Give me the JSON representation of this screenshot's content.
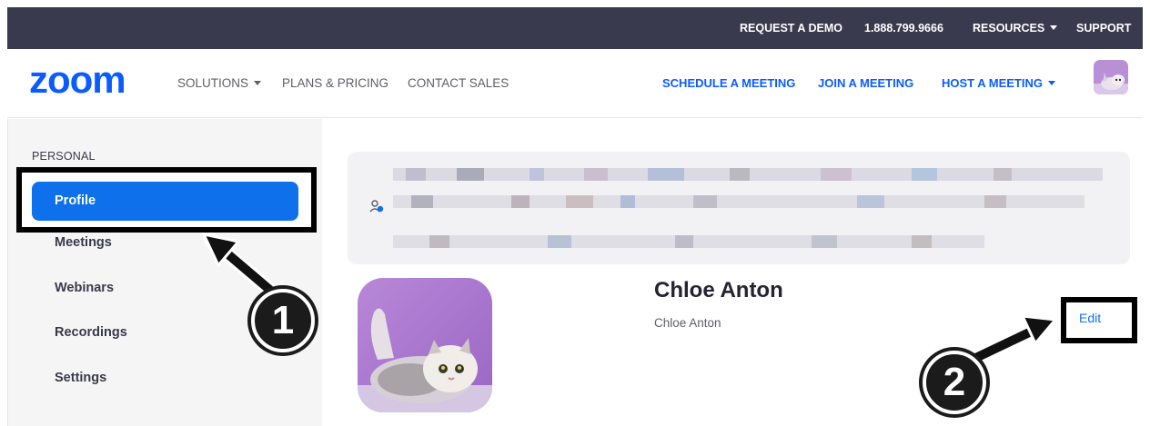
{
  "topbar": {
    "request_demo": "REQUEST A DEMO",
    "phone": "1.888.799.9666",
    "resources": "RESOURCES",
    "support": "SUPPORT"
  },
  "nav": {
    "logo_text": "zoom",
    "left": {
      "solutions": "SOLUTIONS",
      "plans": "PLANS & PRICING",
      "contact": "CONTACT SALES"
    },
    "right": {
      "schedule": "SCHEDULE A MEETING",
      "join": "JOIN A MEETING",
      "host": "HOST A MEETING"
    }
  },
  "sidebar": {
    "section": "PERSONAL",
    "items": [
      {
        "label": "Profile",
        "active": true
      },
      {
        "label": "Meetings",
        "active": false
      },
      {
        "label": "Webinars",
        "active": false
      },
      {
        "label": "Recordings",
        "active": false
      },
      {
        "label": "Settings",
        "active": false
      }
    ]
  },
  "profile": {
    "display_name": "Chloe Anton",
    "sub_name": "Chloe Anton",
    "edit_label": "Edit"
  },
  "annotations": {
    "step1": "1",
    "step2": "2"
  },
  "colors": {
    "topbar_bg": "#393a4e",
    "brand_blue": "#0b5cff",
    "active_item": "#0e71eb",
    "sidebar_bg": "#f5f5f6"
  },
  "icons": {
    "caret": "caret-down-icon",
    "person": "person-icon"
  }
}
